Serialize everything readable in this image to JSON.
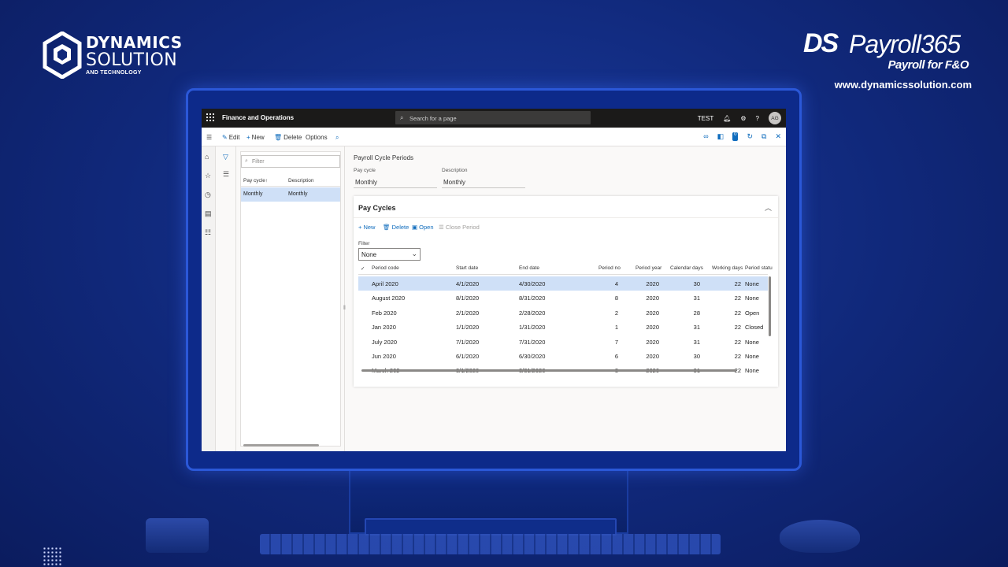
{
  "branding": {
    "left_line1": "DYNAMICS",
    "left_line2": "SOLUTION",
    "left_line3": "AND TECHNOLOGY",
    "right_ds": "DS",
    "right_product": "Payroll365",
    "right_sub": "Payroll for F&O",
    "url": "www.dynamicssolution.com"
  },
  "topbar": {
    "app_title": "Finance and Operations",
    "search_placeholder": "Search for a page",
    "company": "TEST",
    "avatar": "AG",
    "icons": [
      "waffle-icon",
      "search-icon",
      "bell-icon",
      "gear-icon",
      "help-icon"
    ]
  },
  "actionbar": {
    "edit": "Edit",
    "new": "New",
    "delete": "Delete",
    "options": "Options",
    "notification_count": "0"
  },
  "list": {
    "filter_placeholder": "Filter",
    "col_paycycle": "Pay cycle",
    "sort_indicator": "↑",
    "col_description": "Description",
    "rows": [
      {
        "pay_cycle": "Monthly",
        "description": "Monthly"
      }
    ]
  },
  "detail": {
    "page_title": "Payroll Cycle Periods",
    "pay_cycle_label": "Pay cycle",
    "pay_cycle_value": "Monthly",
    "description_label": "Description",
    "description_value": "Monthly"
  },
  "paycycles": {
    "title": "Pay Cycles",
    "toolbar": {
      "new": "New",
      "delete": "Delete",
      "open": "Open",
      "close_period": "Close Period"
    },
    "filter_label": "Filter",
    "filter_value": "None",
    "columns": {
      "period_code": "Period code",
      "start_date": "Start date",
      "end_date": "End date",
      "period_no": "Period no",
      "period_year": "Period year",
      "calendar_days": "Calendar days",
      "working_days": "Working days",
      "period_status": "Period statu"
    },
    "rows": [
      {
        "code": "April 2020",
        "start": "4/1/2020",
        "end": "4/30/2020",
        "no": "4",
        "year": "2020",
        "cal": "30",
        "work": "22",
        "status": "None"
      },
      {
        "code": "August 2020",
        "start": "8/1/2020",
        "end": "8/31/2020",
        "no": "8",
        "year": "2020",
        "cal": "31",
        "work": "22",
        "status": "None"
      },
      {
        "code": "Feb 2020",
        "start": "2/1/2020",
        "end": "2/28/2020",
        "no": "2",
        "year": "2020",
        "cal": "28",
        "work": "22",
        "status": "Open"
      },
      {
        "code": "Jan 2020",
        "start": "1/1/2020",
        "end": "1/31/2020",
        "no": "1",
        "year": "2020",
        "cal": "31",
        "work": "22",
        "status": "Closed"
      },
      {
        "code": "July 2020",
        "start": "7/1/2020",
        "end": "7/31/2020",
        "no": "7",
        "year": "2020",
        "cal": "31",
        "work": "22",
        "status": "None"
      },
      {
        "code": "Jun 2020",
        "start": "6/1/2020",
        "end": "6/30/2020",
        "no": "6",
        "year": "2020",
        "cal": "30",
        "work": "22",
        "status": "None"
      },
      {
        "code": "March 202",
        "start": "3/1/2020",
        "end": "3/31/2020",
        "no": "3",
        "year": "2020",
        "cal": "31",
        "work": "22",
        "status": "None"
      }
    ]
  },
  "colors": {
    "background": "#10287a",
    "accent": "#0f6cbd",
    "selected_row": "#cfe0f7",
    "topbar": "#1b1a19"
  }
}
